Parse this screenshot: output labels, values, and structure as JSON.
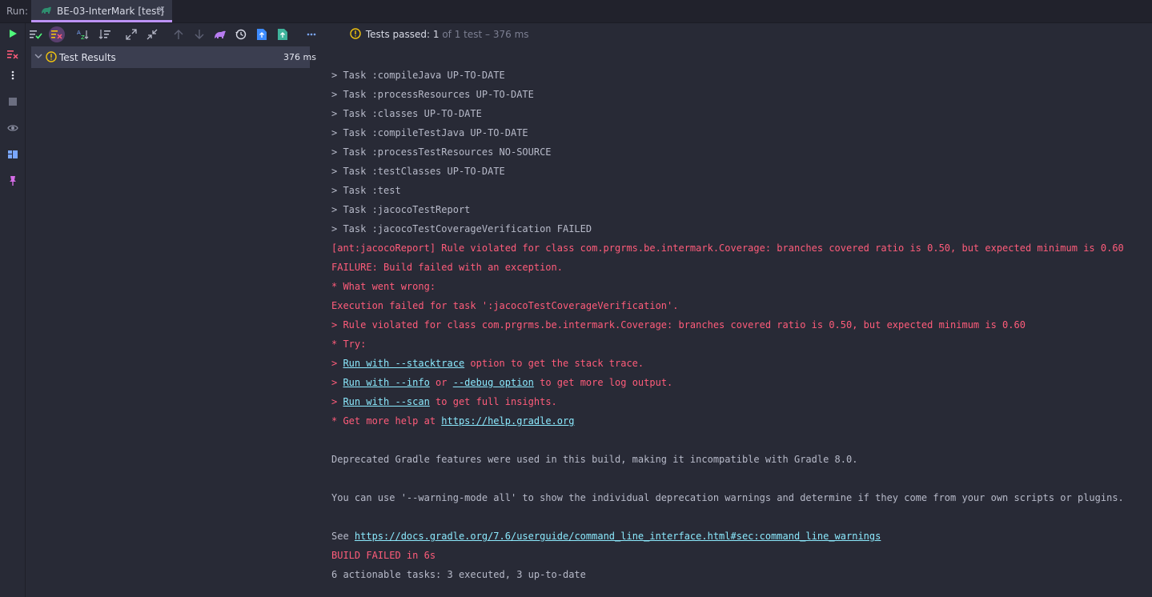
{
  "header": {
    "run_label": "Run:",
    "tab_title": "BE-03-InterMark [test]",
    "tab_close": "×"
  },
  "toolbar": {
    "icons": [
      "rerun-icon",
      "rerun-failed-icon",
      "toggle-passed-icon",
      "sort-alpha-icon",
      "sort-duration-icon",
      "expand-all-icon",
      "collapse-all-icon",
      "prev-failed-icon",
      "next-failed-icon",
      "import-tests-icon",
      "history-icon",
      "export-icon",
      "export-html-icon",
      "more-icon"
    ],
    "status": {
      "prefix": "Tests passed:",
      "passed": "1",
      "rest": "of 1 test – 376 ms"
    }
  },
  "tree": {
    "root_label": "Test Results",
    "root_time": "376 ms"
  },
  "console": {
    "lines": [
      {
        "parts": [
          {
            "t": "> Task :compileJava UP-TO-DATE",
            "s": "plain"
          }
        ]
      },
      {
        "parts": [
          {
            "t": "> Task :processResources UP-TO-DATE",
            "s": "plain"
          }
        ]
      },
      {
        "parts": [
          {
            "t": "> Task :classes UP-TO-DATE",
            "s": "plain"
          }
        ]
      },
      {
        "parts": [
          {
            "t": "> Task :compileTestJava UP-TO-DATE",
            "s": "plain"
          }
        ]
      },
      {
        "parts": [
          {
            "t": "> Task :processTestResources NO-SOURCE",
            "s": "plain"
          }
        ]
      },
      {
        "parts": [
          {
            "t": "> Task :testClasses UP-TO-DATE",
            "s": "plain"
          }
        ]
      },
      {
        "parts": [
          {
            "t": "> Task :test",
            "s": "plain"
          }
        ]
      },
      {
        "parts": [
          {
            "t": "> Task :jacocoTestReport",
            "s": "plain"
          }
        ]
      },
      {
        "parts": [
          {
            "t": "> Task :jacocoTestCoverageVerification FAILED",
            "s": "plain"
          }
        ]
      },
      {
        "parts": [
          {
            "t": "[ant:jacocoReport] Rule violated for class com.prgrms.be.intermark.Coverage: branches covered ratio is 0.50, but expected minimum is 0.60",
            "s": "err"
          }
        ]
      },
      {
        "parts": [
          {
            "t": "FAILURE: Build failed with an exception.",
            "s": "err"
          }
        ]
      },
      {
        "parts": [
          {
            "t": "* What went wrong:",
            "s": "err"
          }
        ]
      },
      {
        "parts": [
          {
            "t": "Execution failed for task ':jacocoTestCoverageVerification'.",
            "s": "err"
          }
        ]
      },
      {
        "parts": [
          {
            "t": "> Rule violated for class com.prgrms.be.intermark.Coverage: branches covered ratio is 0.50, but expected minimum is 0.60",
            "s": "err"
          }
        ]
      },
      {
        "parts": [
          {
            "t": "* Try:",
            "s": "err"
          }
        ]
      },
      {
        "parts": [
          {
            "t": "> ",
            "s": "err"
          },
          {
            "t": "Run with --stacktrace",
            "s": "link"
          },
          {
            "t": " option to get the stack trace.",
            "s": "err"
          }
        ]
      },
      {
        "parts": [
          {
            "t": "> ",
            "s": "err"
          },
          {
            "t": "Run with --info",
            "s": "link"
          },
          {
            "t": " or ",
            "s": "err"
          },
          {
            "t": "--debug option",
            "s": "link"
          },
          {
            "t": " to get more log output.",
            "s": "err"
          }
        ]
      },
      {
        "parts": [
          {
            "t": "> ",
            "s": "err"
          },
          {
            "t": "Run with --scan",
            "s": "link"
          },
          {
            "t": " to get full insights.",
            "s": "err"
          }
        ]
      },
      {
        "parts": [
          {
            "t": "* Get more help at ",
            "s": "err"
          },
          {
            "t": "https://help.gradle.org",
            "s": "link"
          }
        ]
      },
      {
        "parts": []
      },
      {
        "parts": [
          {
            "t": "Deprecated Gradle features were used in this build, making it incompatible with Gradle 8.0.",
            "s": "plain"
          }
        ]
      },
      {
        "parts": []
      },
      {
        "parts": [
          {
            "t": "You can use '--warning-mode all' to show the individual deprecation warnings and determine if they come from your own scripts or plugins.",
            "s": "plain"
          }
        ]
      },
      {
        "parts": []
      },
      {
        "parts": [
          {
            "t": "See ",
            "s": "plain"
          },
          {
            "t": "https://docs.gradle.org/7.6/userguide/command_line_interface.html#sec:command_line_warnings",
            "s": "link"
          }
        ]
      },
      {
        "parts": [
          {
            "t": "BUILD FAILED in 6s",
            "s": "err"
          }
        ]
      },
      {
        "parts": [
          {
            "t": "6 actionable tasks: 3 executed, 3 up-to-date",
            "s": "plain"
          }
        ]
      }
    ]
  },
  "colors": {
    "background": "#282a36",
    "accent": "#bd93f9",
    "error": "#ff5c7a",
    "link": "#8be9fd",
    "run_green": "#50fa7b",
    "warning": "#f1c40f"
  }
}
